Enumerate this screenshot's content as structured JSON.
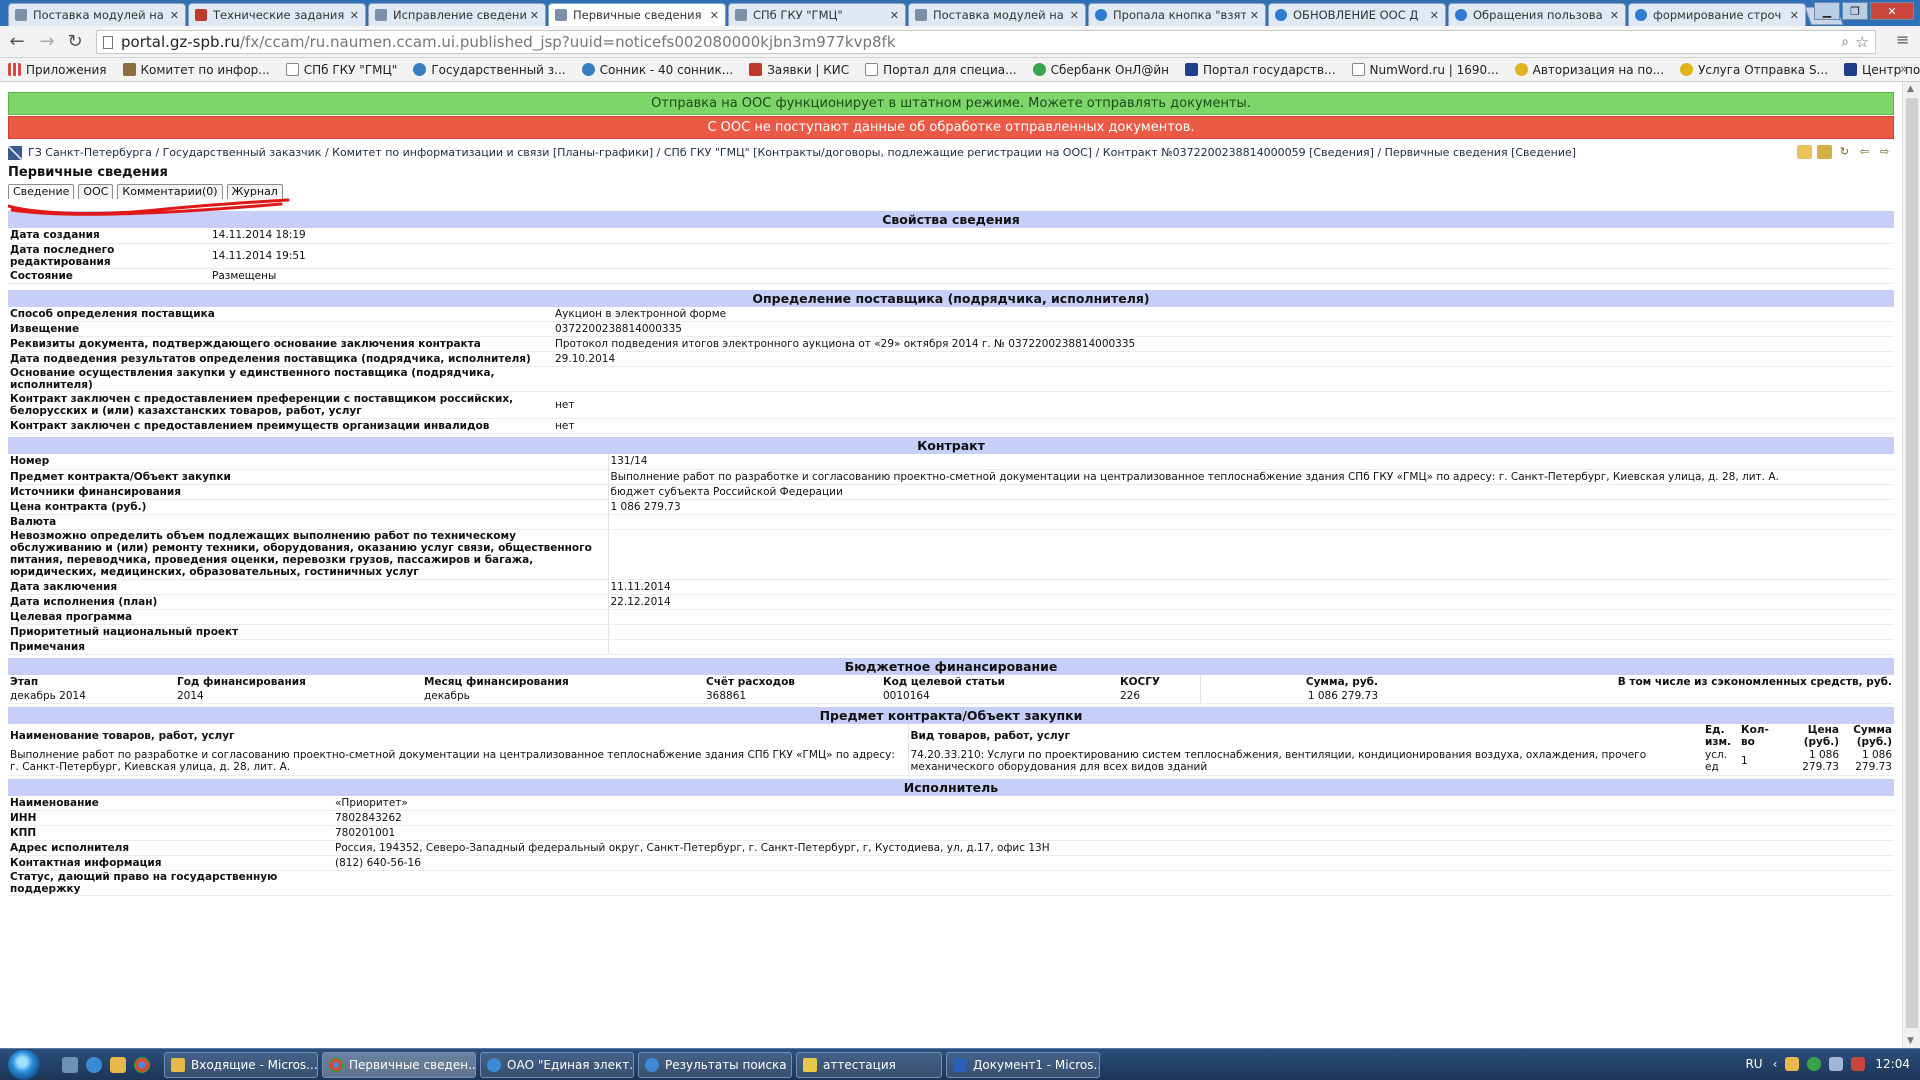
{
  "browser": {
    "tabs": [
      {
        "label": "Поставка модулей на"
      },
      {
        "label": "Технические задания"
      },
      {
        "label": "Исправление сведени"
      },
      {
        "label": "Первичные сведения"
      },
      {
        "label": "СПб ГКУ \"ГМЦ\""
      },
      {
        "label": "Поставка модулей на"
      },
      {
        "label": "Пропала кнопка \"взят"
      },
      {
        "label": "ОБНОВЛЕНИЕ ООС Д"
      },
      {
        "label": "Обращения пользова"
      },
      {
        "label": "формирование строч"
      }
    ],
    "url_host": "portal.gz-spb.ru",
    "url_path": "/fx/ccam/ru.naumen.ccam.ui.published_jsp?uuid=noticefs002080000kjbn3m977kvp8fk",
    "bookmarks": [
      {
        "label": "Приложения"
      },
      {
        "label": "Комитет по инфор..."
      },
      {
        "label": "СПб ГКУ \"ГМЦ\""
      },
      {
        "label": "Государственный з..."
      },
      {
        "label": "Сонник - 40 сонник..."
      },
      {
        "label": "Заявки | КИС"
      },
      {
        "label": "Портал для специа..."
      },
      {
        "label": "Сбербанк ОнЛ@йн"
      },
      {
        "label": "Портал государств..."
      },
      {
        "label": "NumWord.ru | 1690..."
      },
      {
        "label": "Авторизация на по..."
      },
      {
        "label": "Услуга Отправка S..."
      },
      {
        "label": "Центр по экономи..."
      }
    ]
  },
  "banners": {
    "ok": "Отправка на ООС функционирует в штатном режиме. Можете отправлять документы.",
    "error": "С ООС не поступают данные об обработке отправленных документов."
  },
  "breadcrumb": "ГЗ Санкт-Петербурга / Государственный заказчик / Комитет по информатизации и связи [Планы-графики] / СПб ГКУ \"ГМЦ\" [Контракты/договоры, подлежащие регистрации на ООС] / Контракт №0372200238814000059 [Сведения] / Первичные сведения [Сведение]",
  "page_title": "Первичные сведения",
  "subtabs": [
    {
      "label": "Сведение"
    },
    {
      "label": "ООС"
    },
    {
      "label": "Комментарии(0)"
    },
    {
      "label": "Журнал"
    }
  ],
  "props": {
    "title": "Свойства сведения",
    "rows": [
      {
        "label": "Дата создания",
        "value": "14.11.2014 18:19"
      },
      {
        "label": "Дата последнего редактирования",
        "value": "14.11.2014 19:51"
      },
      {
        "label": "Состояние",
        "value": "Размещены"
      }
    ]
  },
  "supplier": {
    "title": "Определение поставщика (подрядчика, исполнителя)",
    "rows": [
      {
        "label": "Способ определения поставщика",
        "value": "Аукцион в электронной форме"
      },
      {
        "label": "Извещение",
        "value": "0372200238814000335"
      },
      {
        "label": "Реквизиты документа, подтверждающего основание заключения контракта",
        "value": "Протокол подведения итогов электронного аукциона от «29» октября 2014 г. № 0372200238814000335"
      },
      {
        "label": "Дата подведения результатов определения поставщика (подрядчика, исполнителя)",
        "value": "29.10.2014"
      },
      {
        "label": "Основание осуществления закупки у единственного поставщика (подрядчика, исполнителя)",
        "value": ""
      },
      {
        "label": "Контракт заключен с предоставлением преференции с поставщиком российских, белорусских и (или) казахстанских товаров, работ, услуг",
        "value": "нет"
      },
      {
        "label": "Контракт заключен с предоставлением преимуществ организации инвалидов",
        "value": "нет"
      }
    ]
  },
  "contract": {
    "title": "Контракт",
    "rows": [
      {
        "label": "Номер",
        "value": "131/14"
      },
      {
        "label": "Предмет контракта/Объект закупки",
        "value": "Выполнение работ по разработке и согласованию проектно-сметной документации на централизованное теплоснабжение здания СПб ГКУ «ГМЦ» по адресу: г. Санкт-Петербург, Киевская улица, д. 28, лит. А."
      },
      {
        "label": "Источники финансирования",
        "value": "бюджет субъекта Российской Федерации"
      },
      {
        "label": "Цена контракта (руб.)",
        "value": "1 086 279.73"
      },
      {
        "label": "Валюта",
        "value": ""
      },
      {
        "label": "Невозможно определить объем подлежащих выполнению работ по техническому обслуживанию и (или) ремонту техники, оборудования, оказанию услуг связи, общественного питания, переводчика, проведения оценки, перевозки грузов, пассажиров и багажа, юридических, медицинских, образовательных, гостиничных услуг",
        "value": ""
      },
      {
        "label": "Дата заключения",
        "value": "11.11.2014"
      },
      {
        "label": "Дата исполнения (план)",
        "value": "22.12.2014"
      },
      {
        "label": "Целевая программа",
        "value": ""
      },
      {
        "label": "Приоритетный национальный проект",
        "value": ""
      },
      {
        "label": "Примечания",
        "value": ""
      }
    ]
  },
  "budget": {
    "title": "Бюджетное финансирование",
    "headers": [
      "Этап",
      "Год финансирования",
      "Месяц финансирования",
      "Счёт расходов",
      "Код целевой статьи",
      "КОСГУ",
      "Сумма, руб.",
      "В том числе из сэкономленных средств, руб."
    ],
    "row": [
      "декабрь 2014",
      "2014",
      "декабрь",
      "368861",
      "0010164",
      "226",
      "1 086 279.73",
      ""
    ]
  },
  "subject": {
    "title": "Предмет контракта/Объект закупки",
    "headers": [
      "Наименование товаров, работ, услуг",
      "Вид товаров, работ, услуг",
      "Ед. изм.",
      "Кол-во",
      "Цена (руб.)",
      "Сумма (руб.)"
    ],
    "row": [
      "Выполнение работ по разработке и согласованию проектно-сметной документации на централизованное теплоснабжение здания СПб ГКУ «ГМЦ» по адресу: г. Санкт-Петербург, Киевская улица, д. 28, лит. А.",
      "74.20.33.210: Услуги по проектированию систем теплоснабжения, вентиляции, кондиционирования воздуха, охлаждения, прочего механического оборудования для всех видов зданий",
      "усл. ед",
      "1",
      "1 086 279.73",
      "1 086 279.73"
    ]
  },
  "executor": {
    "title": "Исполнитель",
    "rows": [
      {
        "label": "Наименование",
        "value": "«Приоритет»"
      },
      {
        "label": "ИНН",
        "value": "7802843262"
      },
      {
        "label": "КПП",
        "value": "780201001"
      },
      {
        "label": "Адрес исполнителя",
        "value": "Россия, 194352, Северо-Западный федеральный округ, Санкт-Петербург, г. Санкт-Петербург, г, Кустодиева, ул, д.17, офис 13Н"
      },
      {
        "label": "Контактная информация",
        "value": "(812) 640-56-16"
      },
      {
        "label": "Статус, дающий право на государственную поддержку",
        "value": ""
      }
    ]
  },
  "taskbar": {
    "tasks": [
      {
        "label": "Входящие - Micros..."
      },
      {
        "label": "Первичные сведен..."
      },
      {
        "label": "ОАО \"Единая элект..."
      },
      {
        "label": "Результаты поиска ..."
      },
      {
        "label": "аттестация"
      },
      {
        "label": "Документ1 - Micros..."
      }
    ],
    "lang": "RU",
    "time": "12:04"
  }
}
